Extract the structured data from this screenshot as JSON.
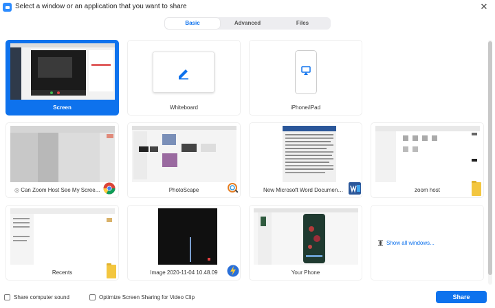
{
  "window": {
    "title": "Select a window or an application that you want to share",
    "close_glyph": "✕"
  },
  "tabs": [
    {
      "label": "Basic",
      "active": true
    },
    {
      "label": "Advanced",
      "active": false
    },
    {
      "label": "Files",
      "active": false
    }
  ],
  "cards": {
    "screen": "Screen",
    "whiteboard": "Whiteboard",
    "iphone": "iPhone/iPad",
    "chrome": "Can Zoom Host See My Scree...",
    "photoscape": "PhotoScape",
    "word": "New Microsoft Word Document (...",
    "zoomhost": "zoom host",
    "recents": "Recents",
    "image": "Image 2020-11-04 10.48.09",
    "yourphone": "Your Phone"
  },
  "show_all": "Show all windows...",
  "options": {
    "computer_sound": "Share computer sound",
    "optimize_video": "Optimize Screen Sharing for Video Clip"
  },
  "share_label": "Share",
  "colors": {
    "accent": "#0e72ed",
    "folder": "#f3c63f"
  }
}
